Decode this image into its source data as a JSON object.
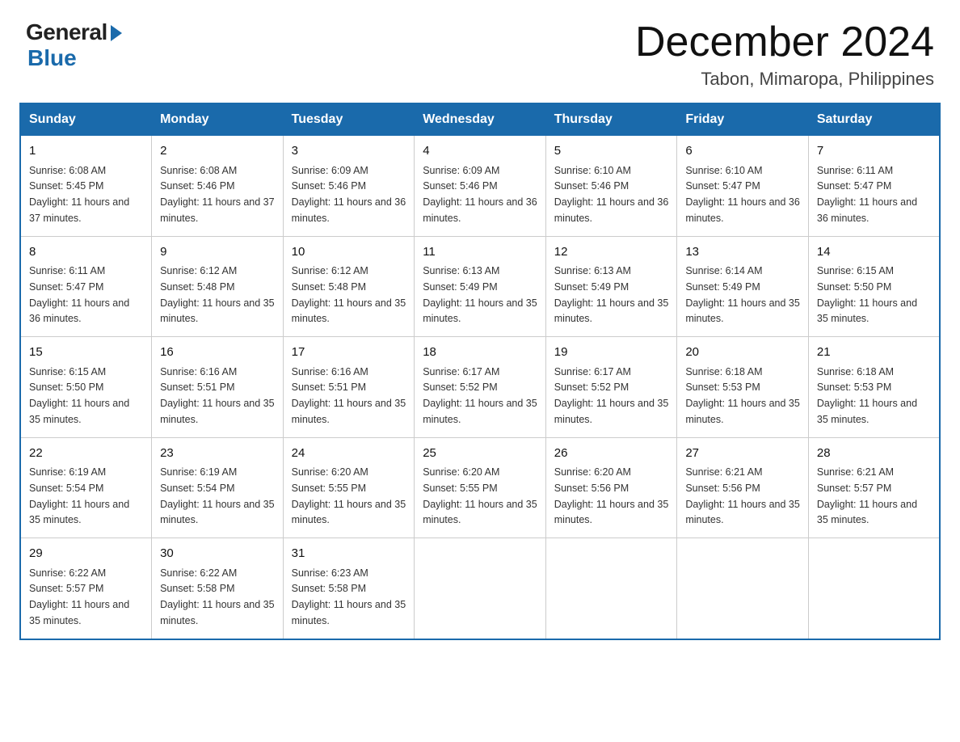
{
  "header": {
    "logo_general": "General",
    "logo_blue": "Blue",
    "month_title": "December 2024",
    "location": "Tabon, Mimaropa, Philippines"
  },
  "days_of_week": [
    "Sunday",
    "Monday",
    "Tuesday",
    "Wednesday",
    "Thursday",
    "Friday",
    "Saturday"
  ],
  "weeks": [
    [
      {
        "day": "1",
        "sunrise": "6:08 AM",
        "sunset": "5:45 PM",
        "daylight": "11 hours and 37 minutes."
      },
      {
        "day": "2",
        "sunrise": "6:08 AM",
        "sunset": "5:46 PM",
        "daylight": "11 hours and 37 minutes."
      },
      {
        "day": "3",
        "sunrise": "6:09 AM",
        "sunset": "5:46 PM",
        "daylight": "11 hours and 36 minutes."
      },
      {
        "day": "4",
        "sunrise": "6:09 AM",
        "sunset": "5:46 PM",
        "daylight": "11 hours and 36 minutes."
      },
      {
        "day": "5",
        "sunrise": "6:10 AM",
        "sunset": "5:46 PM",
        "daylight": "11 hours and 36 minutes."
      },
      {
        "day": "6",
        "sunrise": "6:10 AM",
        "sunset": "5:47 PM",
        "daylight": "11 hours and 36 minutes."
      },
      {
        "day": "7",
        "sunrise": "6:11 AM",
        "sunset": "5:47 PM",
        "daylight": "11 hours and 36 minutes."
      }
    ],
    [
      {
        "day": "8",
        "sunrise": "6:11 AM",
        "sunset": "5:47 PM",
        "daylight": "11 hours and 36 minutes."
      },
      {
        "day": "9",
        "sunrise": "6:12 AM",
        "sunset": "5:48 PM",
        "daylight": "11 hours and 35 minutes."
      },
      {
        "day": "10",
        "sunrise": "6:12 AM",
        "sunset": "5:48 PM",
        "daylight": "11 hours and 35 minutes."
      },
      {
        "day": "11",
        "sunrise": "6:13 AM",
        "sunset": "5:49 PM",
        "daylight": "11 hours and 35 minutes."
      },
      {
        "day": "12",
        "sunrise": "6:13 AM",
        "sunset": "5:49 PM",
        "daylight": "11 hours and 35 minutes."
      },
      {
        "day": "13",
        "sunrise": "6:14 AM",
        "sunset": "5:49 PM",
        "daylight": "11 hours and 35 minutes."
      },
      {
        "day": "14",
        "sunrise": "6:15 AM",
        "sunset": "5:50 PM",
        "daylight": "11 hours and 35 minutes."
      }
    ],
    [
      {
        "day": "15",
        "sunrise": "6:15 AM",
        "sunset": "5:50 PM",
        "daylight": "11 hours and 35 minutes."
      },
      {
        "day": "16",
        "sunrise": "6:16 AM",
        "sunset": "5:51 PM",
        "daylight": "11 hours and 35 minutes."
      },
      {
        "day": "17",
        "sunrise": "6:16 AM",
        "sunset": "5:51 PM",
        "daylight": "11 hours and 35 minutes."
      },
      {
        "day": "18",
        "sunrise": "6:17 AM",
        "sunset": "5:52 PM",
        "daylight": "11 hours and 35 minutes."
      },
      {
        "day": "19",
        "sunrise": "6:17 AM",
        "sunset": "5:52 PM",
        "daylight": "11 hours and 35 minutes."
      },
      {
        "day": "20",
        "sunrise": "6:18 AM",
        "sunset": "5:53 PM",
        "daylight": "11 hours and 35 minutes."
      },
      {
        "day": "21",
        "sunrise": "6:18 AM",
        "sunset": "5:53 PM",
        "daylight": "11 hours and 35 minutes."
      }
    ],
    [
      {
        "day": "22",
        "sunrise": "6:19 AM",
        "sunset": "5:54 PM",
        "daylight": "11 hours and 35 minutes."
      },
      {
        "day": "23",
        "sunrise": "6:19 AM",
        "sunset": "5:54 PM",
        "daylight": "11 hours and 35 minutes."
      },
      {
        "day": "24",
        "sunrise": "6:20 AM",
        "sunset": "5:55 PM",
        "daylight": "11 hours and 35 minutes."
      },
      {
        "day": "25",
        "sunrise": "6:20 AM",
        "sunset": "5:55 PM",
        "daylight": "11 hours and 35 minutes."
      },
      {
        "day": "26",
        "sunrise": "6:20 AM",
        "sunset": "5:56 PM",
        "daylight": "11 hours and 35 minutes."
      },
      {
        "day": "27",
        "sunrise": "6:21 AM",
        "sunset": "5:56 PM",
        "daylight": "11 hours and 35 minutes."
      },
      {
        "day": "28",
        "sunrise": "6:21 AM",
        "sunset": "5:57 PM",
        "daylight": "11 hours and 35 minutes."
      }
    ],
    [
      {
        "day": "29",
        "sunrise": "6:22 AM",
        "sunset": "5:57 PM",
        "daylight": "11 hours and 35 minutes."
      },
      {
        "day": "30",
        "sunrise": "6:22 AM",
        "sunset": "5:58 PM",
        "daylight": "11 hours and 35 minutes."
      },
      {
        "day": "31",
        "sunrise": "6:23 AM",
        "sunset": "5:58 PM",
        "daylight": "11 hours and 35 minutes."
      },
      null,
      null,
      null,
      null
    ]
  ]
}
